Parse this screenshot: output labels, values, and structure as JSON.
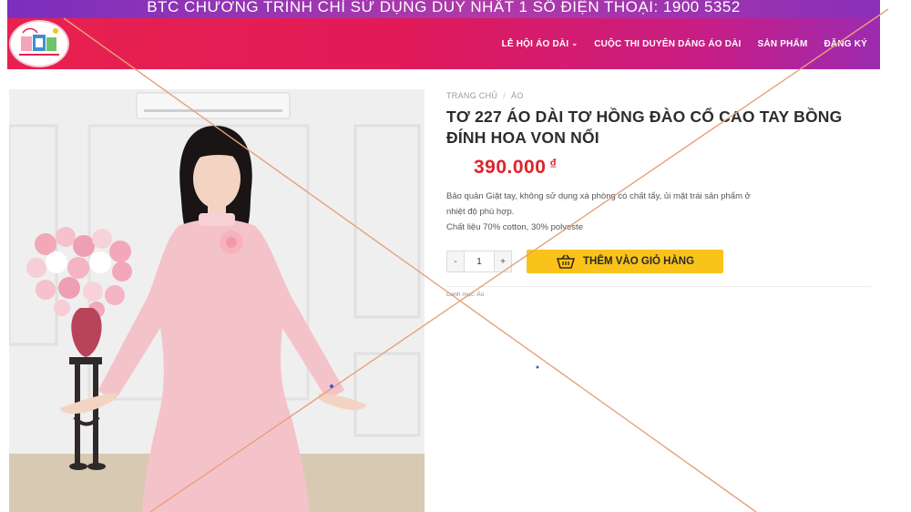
{
  "promo_banner": "BTC CHƯƠNG TRÌNH CHỈ SỬ DỤNG DUY NHẤT 1 SỐ ĐIỆN THOẠI: 1900 5352",
  "nav": {
    "items": [
      {
        "label": "LỄ HỘI ÁO DÀI",
        "has_dropdown": true
      },
      {
        "label": "CUỘC THI DUYÊN DÁNG ÁO DÀI",
        "has_dropdown": false
      },
      {
        "label": "SẢN PHẨM",
        "has_dropdown": false
      },
      {
        "label": "ĐĂNG KÝ",
        "has_dropdown": false
      }
    ]
  },
  "breadcrumb": {
    "home": "TRANG CHỦ",
    "separator": "/",
    "category": "ÁO"
  },
  "product": {
    "title": "TƠ 227 ÁO DÀI TƠ HỒNG ĐÀO CỔ CAO TAY BỒNG ĐÍNH HOA VON NỔI",
    "price": "390.000",
    "currency": "₫",
    "description_line1": "Bảo quản Giặt tay, không sử dụng xà phòng có chất tẩy, ủi mặt trái sản phẩm ở",
    "description_line2": "nhiệt độ phù hợp.",
    "material": "Chất liệu 70% cotton, 30% polyeste",
    "category_meta": "Danh mục: Áo"
  },
  "cart": {
    "quantity": "1",
    "minus_label": "-",
    "plus_label": "+",
    "add_to_cart_label": "THÊM VÀO GIỎ HÀNG"
  },
  "icons": {
    "logo": "ao-dai-festival-logo",
    "cart": "shopping-basket-icon",
    "dropdown": "chevron-down-icon"
  },
  "colors": {
    "header_start": "#e8214f",
    "header_end": "#9c2bb0",
    "promo_bar": "#7b2fbe",
    "price": "#e0222b",
    "cart_button": "#f9c31a",
    "cross_lines": "#e9a07a"
  }
}
